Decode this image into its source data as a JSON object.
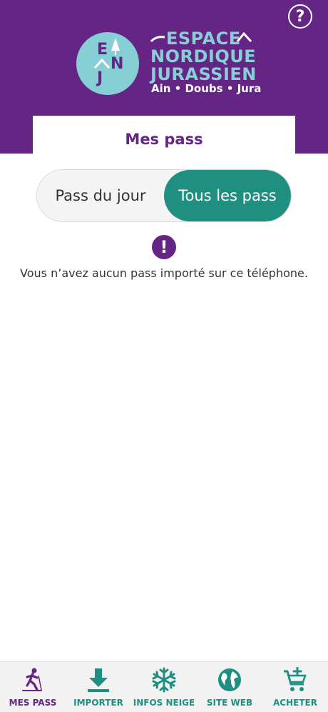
{
  "header": {
    "help_label": "?",
    "logo": {
      "letters": [
        "E",
        "N",
        "J"
      ],
      "lines": [
        "ESPACE",
        "NORDIQUE",
        "JURASSIEN"
      ],
      "subtitle": "Ain • Doubs • Jura"
    }
  },
  "page": {
    "title": "Mes pass"
  },
  "toggle": {
    "options": [
      {
        "label": "Pass du jour",
        "selected": false
      },
      {
        "label": "Tous les pass",
        "selected": true
      }
    ]
  },
  "empty": {
    "icon": "!",
    "message": "Vous n’avez aucun pass importé sur ce téléphone."
  },
  "nav": {
    "items": [
      {
        "label": "MES PASS",
        "icon": "skier-icon",
        "active": true
      },
      {
        "label": "IMPORTER",
        "icon": "download-icon",
        "active": false
      },
      {
        "label": "INFOS NEIGE",
        "icon": "snowflake-icon",
        "active": false
      },
      {
        "label": "SITE WEB",
        "icon": "globe-icon",
        "active": false
      },
      {
        "label": "ACHETER",
        "icon": "cart-add-icon",
        "active": false
      }
    ]
  },
  "colors": {
    "brand_purple": "#652585",
    "teal": "#1f8f82",
    "light_teal": "#86d0d5"
  }
}
